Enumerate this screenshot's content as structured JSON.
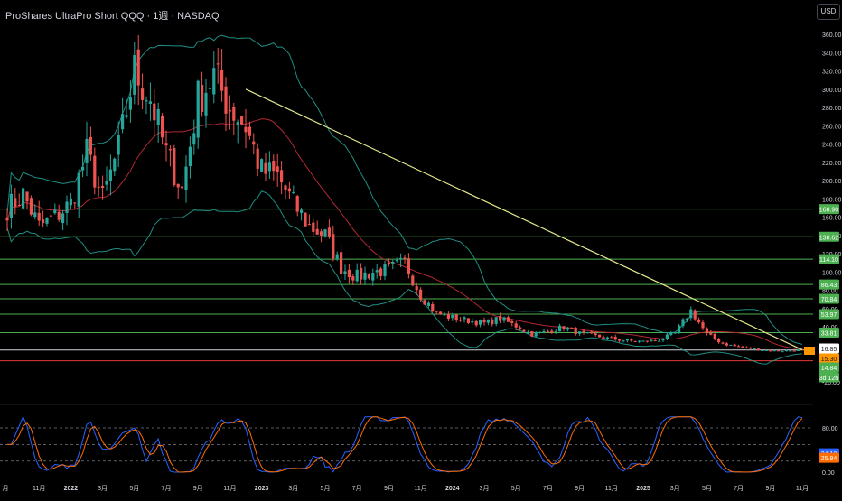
{
  "header": {
    "title": "ProShares UltraPro Short QQQ · 1週 · NASDAQ",
    "currency_button": "USD"
  },
  "colors": {
    "background": "#000000",
    "up": "#26a69a",
    "down": "#ef5350",
    "bb_band": "#26a69a",
    "bb_basis": "#b22833",
    "trendline": "#e6e68c",
    "level_line": "#4caf50",
    "support_line": "#e53935",
    "price_line": "#d1d4dc",
    "stoch_k": "#2962ff",
    "stoch_d": "#ff6d00",
    "text": "#d1d4dc"
  },
  "chart_data": [
    {
      "type": "candlestick",
      "title": "ProShares UltraPro Short QQQ · 1週 · NASDAQ",
      "timeframe": "1週",
      "ylim": [
        -30,
        375
      ],
      "y_ticks": [
        "360.00",
        "340.00",
        "320.00",
        "300.00",
        "280.00",
        "260.00",
        "240.00",
        "220.00",
        "200.00",
        "180.00",
        "160.00",
        "140.00",
        "120.00",
        "100.00",
        "80.00",
        "60.00",
        "40.00",
        "20.00",
        "0.00",
        "-20.00"
      ],
      "x_ticks": [
        "月",
        "11月",
        "2022",
        "3月",
        "5月",
        "7月",
        "9月",
        "11月",
        "2023",
        "3月",
        "5月",
        "7月",
        "9月",
        "11月",
        "2024",
        "3月",
        "5月",
        "7月",
        "9月",
        "11月",
        "2025",
        "3月",
        "5月",
        "7月",
        "9月",
        "11月"
      ],
      "candles_note": "weekly OHLC, 2021-09 to 2025-11, key points",
      "price_path": [
        [
          "2021-09",
          170
        ],
        [
          "2021-10",
          185
        ],
        [
          "2021-11",
          150
        ],
        [
          "2021-12",
          160
        ],
        [
          "2022-01",
          175
        ],
        [
          "2022-02",
          230
        ],
        [
          "2022-03",
          180
        ],
        [
          "2022-04",
          235
        ],
        [
          "2022-05",
          320
        ],
        [
          "2022-06",
          290
        ],
        [
          "2022-07",
          230
        ],
        [
          "2022-08",
          190
        ],
        [
          "2022-09",
          290
        ],
        [
          "2022-10",
          315
        ],
        [
          "2022-11",
          280
        ],
        [
          "2022-12",
          260
        ],
        [
          "2023-01",
          210
        ],
        [
          "2023-02",
          205
        ],
        [
          "2023-03",
          175
        ],
        [
          "2023-04",
          150
        ],
        [
          "2023-05",
          140
        ],
        [
          "2023-06",
          105
        ],
        [
          "2023-07",
          95
        ],
        [
          "2023-08",
          100
        ],
        [
          "2023-09",
          103
        ],
        [
          "2023-10",
          110
        ],
        [
          "2023-11",
          75
        ],
        [
          "2023-12",
          55
        ],
        [
          "2024-01",
          50
        ],
        [
          "2024-02",
          47
        ],
        [
          "2024-03",
          44
        ],
        [
          "2024-04",
          49
        ],
        [
          "2024-05",
          41
        ],
        [
          "2024-06",
          32
        ],
        [
          "2024-07",
          35
        ],
        [
          "2024-08",
          40
        ],
        [
          "2024-09",
          33
        ],
        [
          "2024-10",
          30
        ],
        [
          "2024-11",
          27
        ],
        [
          "2024-12",
          25
        ],
        [
          "2025-01",
          24
        ],
        [
          "2025-02",
          26
        ],
        [
          "2025-03",
          33
        ],
        [
          "2025-04",
          58
        ],
        [
          "2025-05",
          32
        ],
        [
          "2025-06",
          22
        ],
        [
          "2025-07",
          18
        ],
        [
          "2025-08",
          16
        ],
        [
          "2025-09",
          14
        ],
        [
          "2025-10",
          14
        ],
        [
          "2025-11",
          15.3
        ]
      ],
      "trendline": {
        "from": [
          "2022-12",
          300
        ],
        "to": [
          "2025-11",
          15
        ]
      },
      "horizontal_levels": [
        {
          "label": "168.90",
          "value": 168.9,
          "color": "#4caf50"
        },
        {
          "label": "138.62",
          "value": 138.62,
          "color": "#4caf50"
        },
        {
          "label": "114.10",
          "value": 114.1,
          "color": "#4caf50"
        },
        {
          "label": "86.43",
          "value": 86.43,
          "color": "#4caf50"
        },
        {
          "label": "70.84",
          "value": 70.84,
          "color": "#4caf50"
        },
        {
          "label": "53.97",
          "value": 53.97,
          "color": "#4caf50"
        },
        {
          "label": "33.81",
          "value": 33.81,
          "color": "#4caf50"
        },
        {
          "label": "3.06",
          "value": 3.06,
          "color": "#e53935"
        }
      ],
      "price_labels": [
        {
          "text": "16.85",
          "value": 16.85,
          "bg": "#ffffff",
          "fg": "#131722"
        },
        {
          "text": "15.30",
          "value": 15.3,
          "bg": "#ff9800",
          "fg": "#131722"
        },
        {
          "text": "14.84",
          "value": 14.84,
          "bg": "#4caf50",
          "fg": "#ffffff"
        },
        {
          "text": "3d 12h",
          "value": 10.5,
          "bg": "#4caf50",
          "fg": "#ffffff"
        }
      ],
      "current_price": 14.84
    },
    {
      "type": "line",
      "name": "Stochastic RSI",
      "ylim": [
        -5,
        100
      ],
      "y_ticks": [
        "80.00",
        "0.00"
      ],
      "reference_lines": [
        80,
        50,
        20
      ],
      "series": [
        {
          "name": "K",
          "color": "#2962ff",
          "last": 34.18
        },
        {
          "name": "D",
          "color": "#ff6d00",
          "last": 25.94
        }
      ],
      "value_labels": [
        "34.18",
        "25.94"
      ]
    }
  ]
}
